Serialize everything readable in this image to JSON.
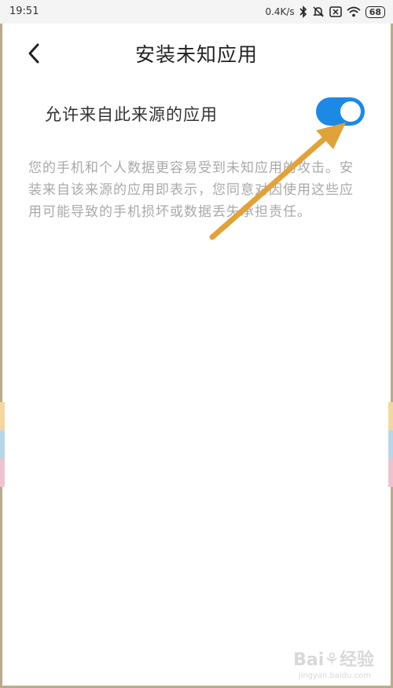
{
  "status_bar": {
    "time": "19:51",
    "net_speed": "0.4K/s",
    "icons": [
      "bluetooth-icon",
      "mute-icon",
      "sim-x-icon",
      "wifi-icon"
    ],
    "battery": "68"
  },
  "header": {
    "back_icon": "chevron-left-icon",
    "title": "安装未知应用"
  },
  "setting": {
    "label": "允许来自此来源的应用",
    "toggle_on": true
  },
  "warning": "您的手机和个人数据更容易受到未知应用的攻击。安装来自该来源的应用即表示，您同意对因使用这些应用可能导致的手机损坏或数据丢失承担责任。",
  "watermark": {
    "brand": "Bai⚘经验",
    "url": "jingyan.baidu.com"
  },
  "colors": {
    "accent": "#1e88e5",
    "annotation_arrow": "#e0a23a",
    "warning_text": "#a9a9a9"
  }
}
